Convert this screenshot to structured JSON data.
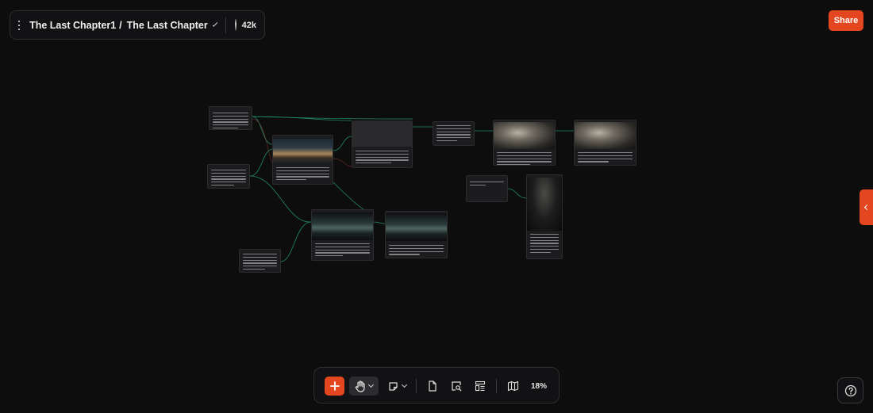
{
  "header": {
    "project": "The Last Chapter1",
    "separator": "/",
    "page": "The Last Chapter",
    "credits": "42k"
  },
  "share_label": "Share",
  "toolbar": {
    "add_label": "+",
    "zoom": "18%",
    "tools": [
      "hand-tool",
      "sticky-note",
      "document",
      "image-search",
      "layout",
      "map"
    ]
  },
  "colors": {
    "accent": "#e4461f",
    "background": "#0e0d0e",
    "link": "#24a07a"
  }
}
